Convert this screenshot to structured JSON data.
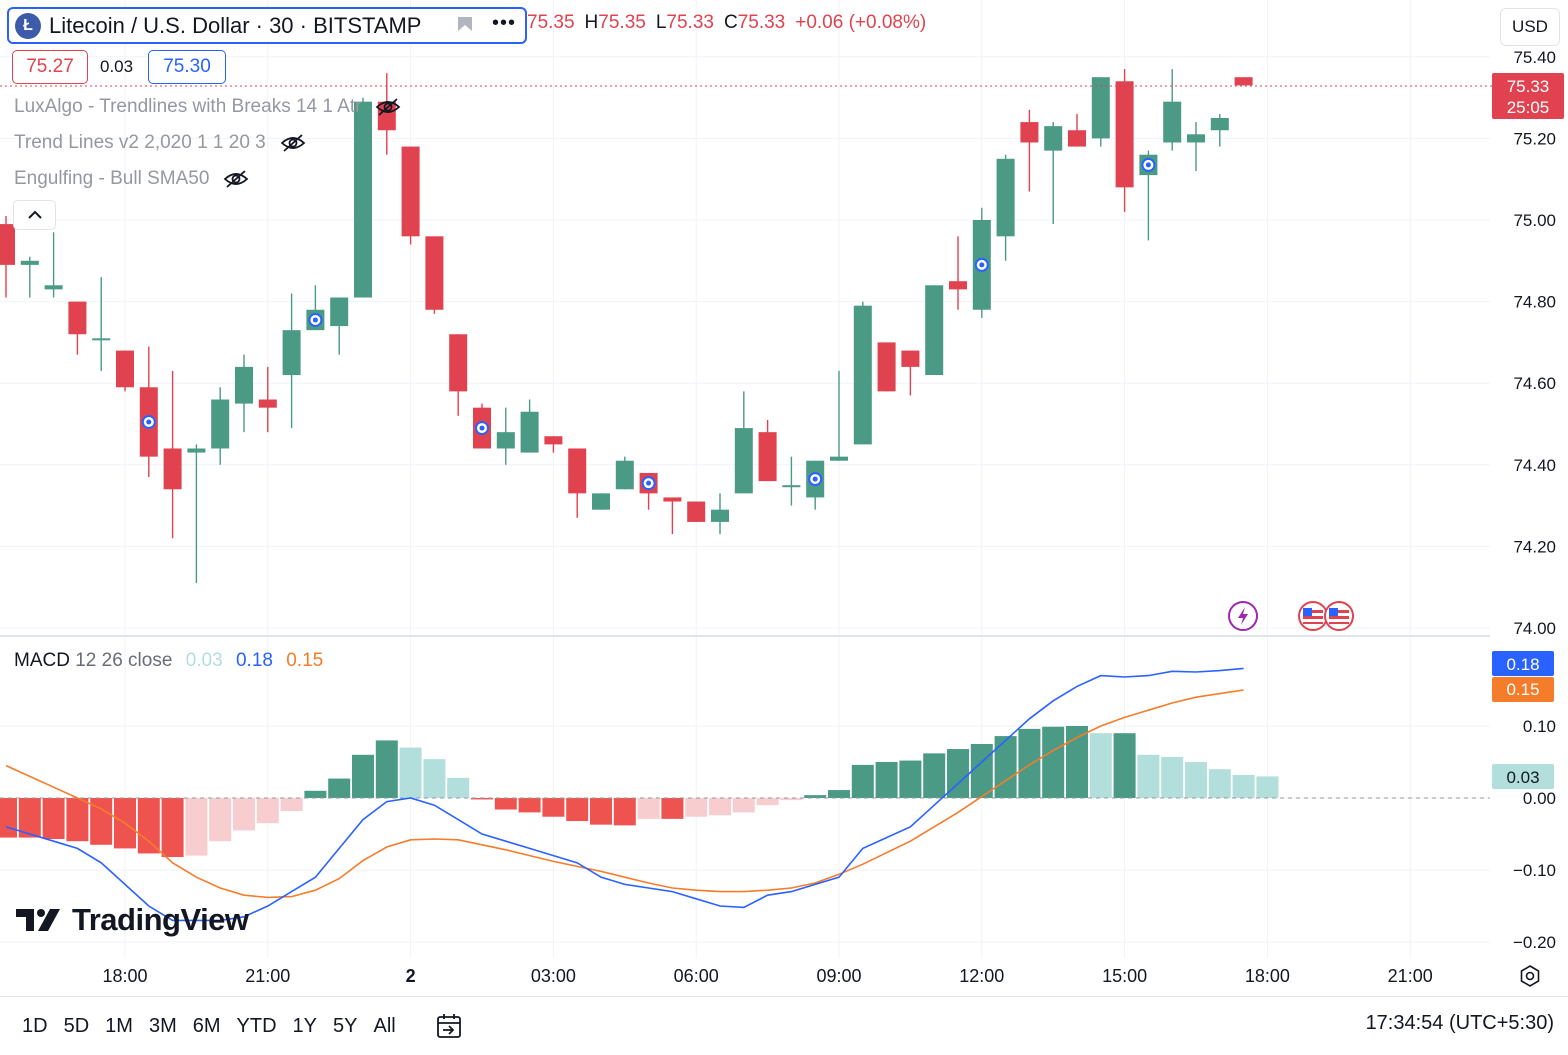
{
  "header": {
    "symbol_title": "Litecoin / U.S. Dollar · 30 · BITSTAMP",
    "symbol_logo": "Ł",
    "ohlc": {
      "o_label": "",
      "o_value": "75.35",
      "h_label": "H",
      "h_value": "75.35",
      "l_label": "L",
      "l_value": "75.33",
      "c_label": "C",
      "c_value": "75.33",
      "change": "+0.06 (+0.08%)"
    },
    "more_icon": "•••",
    "currency": "USD"
  },
  "quote": {
    "bid": "75.27",
    "spread": "0.03",
    "ask": "75.30"
  },
  "indicators": [
    {
      "label": "LuxAlgo - Trendlines with Breaks 14 1 Atr"
    },
    {
      "label": "Trend Lines v2 2,020 1 1 20 3"
    },
    {
      "label": "Engulfing - Bull SMA50"
    }
  ],
  "price_badge": {
    "price": "75.33",
    "countdown": "25:05"
  },
  "macd_legend": {
    "name": "MACD",
    "params": "12 26 close",
    "hist": "0.03",
    "macd": "0.18",
    "signal": "0.15"
  },
  "macd_badges": {
    "macd": "0.18",
    "signal": "0.15",
    "hist": "0.03"
  },
  "brand": {
    "name": "TradingView"
  },
  "ranges": [
    "1D",
    "5D",
    "1M",
    "3M",
    "6M",
    "YTD",
    "1Y",
    "5Y",
    "All"
  ],
  "clock": "17:34:54 (UTC+5:30)",
  "colors": {
    "up": "#4a9a85",
    "down": "#e0424f",
    "macd": "#2962ff",
    "signal": "#f57c2a",
    "hist_up_strong": "#4a9a85",
    "hist_up_weak": "#b2dfdb",
    "hist_down_strong": "#ef5350",
    "hist_down_weak": "#f8cdd0"
  },
  "chart_data": {
    "type": "candlestick",
    "price_axis": {
      "ticks": [
        "75.40",
        "75.20",
        "75.00",
        "74.80",
        "74.60",
        "74.40",
        "74.20",
        "74.00"
      ],
      "ylim": [
        74.0,
        75.4
      ]
    },
    "time_axis": {
      "ticks": [
        "18:00",
        "21:00",
        "2",
        "03:00",
        "06:00",
        "09:00",
        "12:00",
        "15:00",
        "18:00",
        "21:00"
      ]
    },
    "candles": [
      {
        "o": 74.99,
        "h": 75.01,
        "l": 74.81,
        "c": 74.89
      },
      {
        "o": 74.89,
        "h": 74.91,
        "l": 74.81,
        "c": 74.9
      },
      {
        "o": 74.83,
        "h": 74.97,
        "l": 74.81,
        "c": 74.84
      },
      {
        "o": 74.8,
        "h": 74.8,
        "l": 74.67,
        "c": 74.72
      },
      {
        "o": 74.71,
        "h": 74.86,
        "l": 74.63,
        "c": 74.71
      },
      {
        "o": 74.68,
        "h": 74.68,
        "l": 74.58,
        "c": 74.59
      },
      {
        "o": 74.59,
        "h": 74.69,
        "l": 74.37,
        "c": 74.42
      },
      {
        "o": 74.44,
        "h": 74.63,
        "l": 74.22,
        "c": 74.34
      },
      {
        "o": 74.43,
        "h": 74.45,
        "l": 74.11,
        "c": 74.44
      },
      {
        "o": 74.44,
        "h": 74.59,
        "l": 74.4,
        "c": 74.56
      },
      {
        "o": 74.55,
        "h": 74.67,
        "l": 74.48,
        "c": 74.64
      },
      {
        "o": 74.56,
        "h": 74.64,
        "l": 74.48,
        "c": 74.54
      },
      {
        "o": 74.62,
        "h": 74.82,
        "l": 74.49,
        "c": 74.73
      },
      {
        "o": 74.73,
        "h": 74.84,
        "l": 74.73,
        "c": 74.78
      },
      {
        "o": 74.74,
        "h": 74.8,
        "l": 74.67,
        "c": 74.81
      },
      {
        "o": 74.81,
        "h": 75.3,
        "l": 74.81,
        "c": 75.29
      },
      {
        "o": 75.29,
        "h": 75.36,
        "l": 75.16,
        "c": 75.22
      },
      {
        "o": 75.18,
        "h": 75.18,
        "l": 74.94,
        "c": 74.96
      },
      {
        "o": 74.96,
        "h": 74.96,
        "l": 74.77,
        "c": 74.78
      },
      {
        "o": 74.72,
        "h": 74.72,
        "l": 74.52,
        "c": 74.58
      },
      {
        "o": 74.54,
        "h": 74.55,
        "l": 74.44,
        "c": 74.44
      },
      {
        "o": 74.44,
        "h": 74.54,
        "l": 74.4,
        "c": 74.48
      },
      {
        "o": 74.43,
        "h": 74.56,
        "l": 74.43,
        "c": 74.53
      },
      {
        "o": 74.47,
        "h": 74.47,
        "l": 74.43,
        "c": 74.45
      },
      {
        "o": 74.44,
        "h": 74.44,
        "l": 74.27,
        "c": 74.33
      },
      {
        "o": 74.29,
        "h": 74.33,
        "l": 74.29,
        "c": 74.33
      },
      {
        "o": 74.34,
        "h": 74.42,
        "l": 74.34,
        "c": 74.41
      },
      {
        "o": 74.38,
        "h": 74.38,
        "l": 74.29,
        "c": 74.33
      },
      {
        "o": 74.32,
        "h": 74.32,
        "l": 74.23,
        "c": 74.31
      },
      {
        "o": 74.31,
        "h": 74.31,
        "l": 74.26,
        "c": 74.26
      },
      {
        "o": 74.26,
        "h": 74.33,
        "l": 74.23,
        "c": 74.29
      },
      {
        "o": 74.33,
        "h": 74.58,
        "l": 74.33,
        "c": 74.49
      },
      {
        "o": 74.48,
        "h": 74.51,
        "l": 74.36,
        "c": 74.36
      },
      {
        "o": 74.35,
        "h": 74.42,
        "l": 74.3,
        "c": 74.35
      },
      {
        "o": 74.32,
        "h": 74.41,
        "l": 74.29,
        "c": 74.41
      },
      {
        "o": 74.41,
        "h": 74.63,
        "l": 74.41,
        "c": 74.42
      },
      {
        "o": 74.45,
        "h": 74.8,
        "l": 74.45,
        "c": 74.79
      },
      {
        "o": 74.7,
        "h": 74.7,
        "l": 74.58,
        "c": 74.58
      },
      {
        "o": 74.68,
        "h": 74.68,
        "l": 74.57,
        "c": 74.64
      },
      {
        "o": 74.62,
        "h": 74.84,
        "l": 74.62,
        "c": 74.84
      },
      {
        "o": 74.85,
        "h": 74.96,
        "l": 74.78,
        "c": 74.83
      },
      {
        "o": 74.78,
        "h": 75.03,
        "l": 74.76,
        "c": 75.0
      },
      {
        "o": 74.96,
        "h": 75.16,
        "l": 74.9,
        "c": 75.15
      },
      {
        "o": 75.24,
        "h": 75.27,
        "l": 75.07,
        "c": 75.19
      },
      {
        "o": 75.17,
        "h": 75.24,
        "l": 74.99,
        "c": 75.23
      },
      {
        "o": 75.22,
        "h": 75.26,
        "l": 75.18,
        "c": 75.18
      },
      {
        "o": 75.2,
        "h": 75.35,
        "l": 75.18,
        "c": 75.35
      },
      {
        "o": 75.34,
        "h": 75.37,
        "l": 75.02,
        "c": 75.08
      },
      {
        "o": 75.11,
        "h": 75.17,
        "l": 74.95,
        "c": 75.16
      },
      {
        "o": 75.19,
        "h": 75.37,
        "l": 75.17,
        "c": 75.29
      },
      {
        "o": 75.19,
        "h": 75.24,
        "l": 75.12,
        "c": 75.21
      },
      {
        "o": 75.22,
        "h": 75.26,
        "l": 75.18,
        "c": 75.25
      },
      {
        "o": 75.35,
        "h": 75.35,
        "l": 75.33,
        "c": 75.33
      }
    ],
    "signal_markers": [
      6,
      13,
      20,
      27,
      34,
      41,
      48
    ],
    "macd_axis": {
      "ticks": [
        "0.10",
        "0.00",
        "−0.10",
        "−0.20"
      ],
      "ylim": [
        -0.2,
        0.18
      ]
    },
    "macd_series": [
      {
        "name": "MACD",
        "values": [
          -0.04,
          -0.05,
          -0.06,
          -0.07,
          -0.09,
          -0.12,
          -0.15,
          -0.17,
          -0.17,
          -0.17,
          -0.165,
          -0.15,
          -0.13,
          -0.11,
          -0.07,
          -0.03,
          -0.005,
          0.0,
          -0.01,
          -0.03,
          -0.05,
          -0.06,
          -0.07,
          -0.08,
          -0.09,
          -0.11,
          -0.12,
          -0.125,
          -0.13,
          -0.14,
          -0.15,
          -0.152,
          -0.135,
          -0.13,
          -0.12,
          -0.11,
          -0.07,
          -0.055,
          -0.04,
          -0.01,
          0.02,
          0.05,
          0.08,
          0.11,
          0.135,
          0.155,
          0.17,
          0.168,
          0.17,
          0.176,
          0.175,
          0.177,
          0.18
        ]
      },
      {
        "name": "Signal",
        "values": [
          0.045,
          0.03,
          0.015,
          0.0,
          -0.015,
          -0.035,
          -0.06,
          -0.09,
          -0.11,
          -0.125,
          -0.135,
          -0.138,
          -0.137,
          -0.128,
          -0.112,
          -0.087,
          -0.068,
          -0.058,
          -0.057,
          -0.058,
          -0.065,
          -0.072,
          -0.08,
          -0.088,
          -0.095,
          -0.102,
          -0.11,
          -0.118,
          -0.125,
          -0.128,
          -0.13,
          -0.13,
          -0.128,
          -0.125,
          -0.118,
          -0.106,
          -0.092,
          -0.076,
          -0.06,
          -0.04,
          -0.02,
          0.002,
          0.024,
          0.046,
          0.066,
          0.084,
          0.1,
          0.112,
          0.122,
          0.132,
          0.14,
          0.145,
          0.15
        ]
      }
    ],
    "macd_histogram": [
      -0.055,
      -0.055,
      -0.057,
      -0.06,
      -0.065,
      -0.07,
      -0.077,
      -0.082,
      -0.08,
      -0.06,
      -0.045,
      -0.035,
      -0.018,
      0.01,
      0.027,
      0.06,
      0.08,
      0.07,
      0.054,
      0.028,
      -0.002,
      -0.016,
      -0.02,
      -0.026,
      -0.032,
      -0.037,
      -0.038,
      -0.029,
      -0.029,
      -0.026,
      -0.024,
      -0.02,
      -0.01,
      -0.003,
      0.004,
      0.011,
      0.046,
      0.05,
      0.052,
      0.062,
      0.068,
      0.075,
      0.086,
      0.096,
      0.099,
      0.1,
      0.09,
      0.09,
      0.06,
      0.057,
      0.05,
      0.04,
      0.032,
      0.03
    ]
  }
}
